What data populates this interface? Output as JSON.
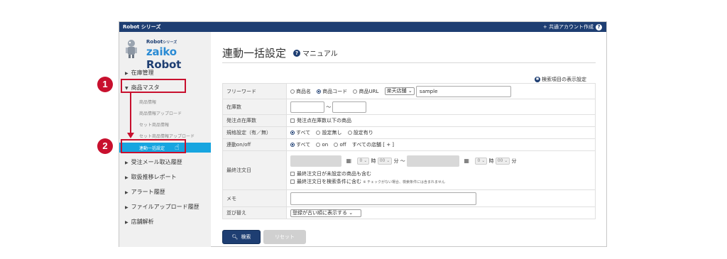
{
  "topbar": {
    "brand": "Robot シリーズ",
    "account_link": "+ 共通アカウント作成",
    "help": "?"
  },
  "logo": {
    "series": "Robot シリーズ",
    "series_main": "Robot",
    "series_small": "シリーズ",
    "name_a": "zaiko",
    "name_b": " Robot"
  },
  "sidebar": {
    "items": [
      {
        "label": "在庫管理"
      },
      {
        "label": "商品マスタ"
      },
      {
        "label": "受注メール取込履歴"
      },
      {
        "label": "取扱推移レポート"
      },
      {
        "label": "アラート履歴"
      },
      {
        "label": "ファイルアップロード履歴"
      },
      {
        "label": "店舗解析"
      }
    ],
    "subitems": [
      {
        "label": "商品情報"
      },
      {
        "label": "商品情報アップロード"
      },
      {
        "label": "セット商品情報"
      },
      {
        "label": "セット商品情報アップロード"
      },
      {
        "label": "連動一括設定"
      }
    ]
  },
  "page": {
    "title": "連動一括設定",
    "manual": "マニュアル",
    "settings_link": "検索項目の表示設定"
  },
  "form": {
    "freeword": {
      "label": "フリーワード",
      "opt1": "商品名",
      "opt2": "商品コード",
      "opt3": "商品URL",
      "store": "楽天店舗",
      "value": "sample"
    },
    "stock": {
      "label": "在庫数",
      "sep": "〜"
    },
    "reorder": {
      "label": "発注点在庫数",
      "check": "発注点在庫数以下の商品"
    },
    "spec": {
      "label": "規格設定（有／無）",
      "opt1": "すべて",
      "opt2": "設定無し",
      "opt3": "設定有り"
    },
    "link": {
      "label": "連動on/off",
      "opt1": "すべて",
      "opt2": "on",
      "opt3": "off",
      "extra": "すべての店舗 [ + ]"
    },
    "lastorder": {
      "label": "最終注文日",
      "h1": "0",
      "time_sep1": "時",
      "m1": "00",
      "min_sep1": "分 〜",
      "h2": "0",
      "time_sep2": "時",
      "m2": "00",
      "min_sep2": "分",
      "check1": "最終注文日が未設定の商品も含む",
      "check2": "最終注文日を検索条件に含む",
      "check2_note": "※ チェックがない場合、検索条件には含まれません"
    },
    "memo": {
      "label": "メモ"
    },
    "sort": {
      "label": "並び替え",
      "value": "登録が古い順に表示する"
    }
  },
  "buttons": {
    "search": "検索",
    "reset": "リセット"
  },
  "callouts": {
    "one": "1",
    "two": "2"
  },
  "colors": {
    "topbar": "#1e3e72",
    "active": "#17a5e0",
    "callout": "#c8102e"
  }
}
